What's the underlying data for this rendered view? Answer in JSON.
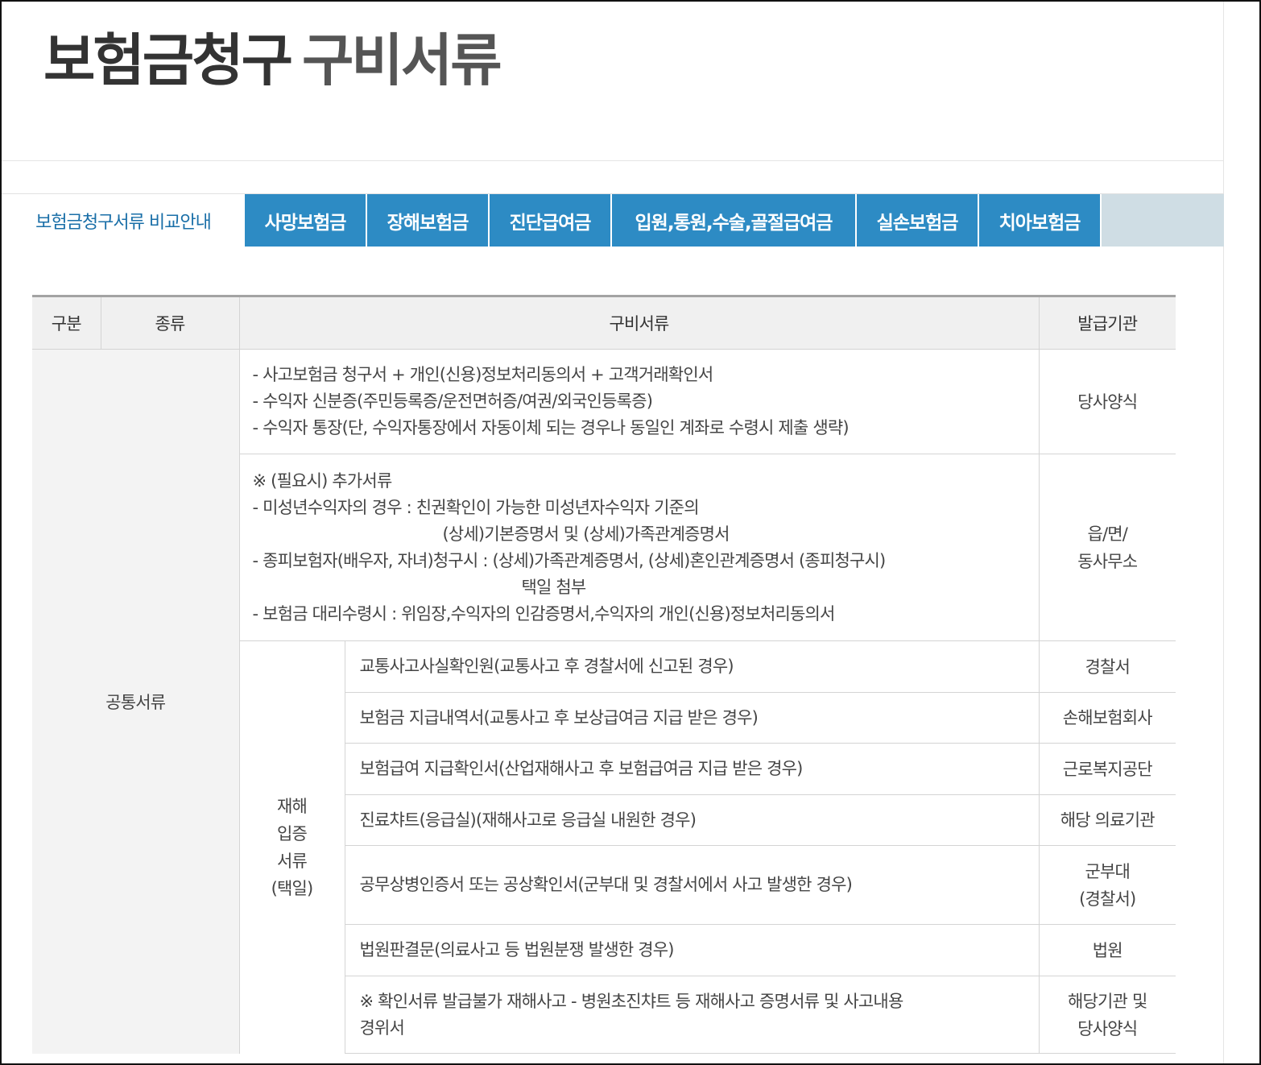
{
  "page": {
    "title_bold": "보험금청구",
    "title_light": "구비서류"
  },
  "tabs": {
    "active": "보험금청구서류 비교안내",
    "items": [
      {
        "label": "사망보험금"
      },
      {
        "label": "장해보험금"
      },
      {
        "label": "진단급여금"
      },
      {
        "label": "입원,통원,수술,골절급여금"
      },
      {
        "label": "실손보험금"
      },
      {
        "label": "치아보험금"
      }
    ]
  },
  "colors": {
    "tab_bg": "#2d8bc4",
    "tab_bar_bg": "#cfdde4",
    "active_tab_text": "#1a6fa8",
    "header_cell_bg": "#f0f0f0"
  },
  "table": {
    "headers": {
      "category": "구분",
      "kind": "종류",
      "documents": "구비서류",
      "issuer": "발급기관"
    },
    "category_label": "공통서류",
    "row1": {
      "lines": [
        "- 사고보험금 청구서 + 개인(신용)정보처리동의서 + 고객거래확인서",
        "- 수익자 신분증(주민등록증/운전면허증/여권/외국인등록증)",
        "- 수익자 통장(단, 수익자통장에서 자동이체 되는 경우나 동일인 계좌로 수령시 제출 생략)"
      ],
      "issuer": "당사양식"
    },
    "row2": {
      "line1": "※ (필요시) 추가서류",
      "line2": "- 미성년수익자의 경우 : 친권확인이 가능한 미성년자수익자 기준의",
      "line3": "(상세)기본증명서 및 (상세)가족관계증명서",
      "line4": "- 종피보험자(배우자, 자녀)청구시 : (상세)가족관계증명서, (상세)혼인관계증명서 (종피청구시)",
      "line5": "택일 첨부",
      "line6": "- 보험금 대리수령시 : 위임장,수익자의 인감증명서,수익자의 개인(신용)정보처리동의서",
      "issuer_line1": "읍/면/",
      "issuer_line2": "동사무소"
    },
    "disaster": {
      "label_lines": [
        "재해",
        "입증",
        "서류",
        "(택일)"
      ],
      "rows": [
        {
          "doc": "교통사고사실확인원(교통사고 후 경찰서에 신고된 경우)",
          "issuer": "경찰서"
        },
        {
          "doc": "보험금 지급내역서(교통사고 후 보상급여금 지급 받은 경우)",
          "issuer": "손해보험회사"
        },
        {
          "doc": "보험급여 지급확인서(산업재해사고 후 보험급여금 지급 받은 경우)",
          "issuer": "근로복지공단"
        },
        {
          "doc": "진료챠트(응급실)(재해사고로 응급실 내원한 경우)",
          "issuer": "해당 의료기관"
        },
        {
          "doc": "공무상병인증서 또는 공상확인서(군부대 및 경찰서에서 사고 발생한 경우)",
          "issuer_line1": "군부대",
          "issuer_line2": "(경찰서)"
        },
        {
          "doc": "법원판결문(의료사고 등 법원분쟁 발생한 경우)",
          "issuer": "법원"
        },
        {
          "doc_line1": "※ 확인서류 발급불가 재해사고 - 병원초진챠트 등 재해사고 증명서류 및 사고내용",
          "doc_line2": "경위서",
          "issuer_line1": "해당기관 및",
          "issuer_line2": "당사양식"
        }
      ]
    }
  }
}
